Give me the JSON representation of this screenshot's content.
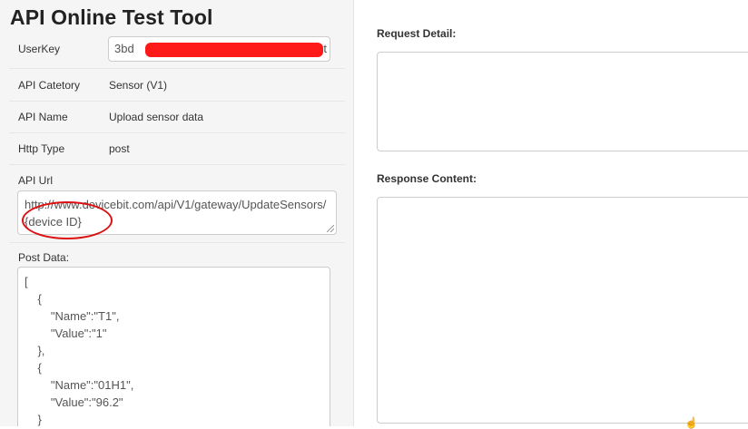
{
  "page": {
    "title": "API Online Test Tool"
  },
  "form": {
    "userkey": {
      "label": "UserKey",
      "value": "3bd",
      "suffix": "t"
    },
    "api_category": {
      "label": "API Catetory",
      "value": "Sensor (V1)"
    },
    "api_name": {
      "label": "API Name",
      "value": "Upload sensor data"
    },
    "http_type": {
      "label": "Http Type",
      "value": "post"
    },
    "api_url": {
      "label": "API Url",
      "value": "http://www.devicebit.com/api/V1/gateway/UpdateSensors/{device ID}"
    },
    "post_data": {
      "label": "Post Data:",
      "value": "[\n    {\n        \"Name\":\"T1\",\n        \"Value\":\"1\"\n    },\n    {\n        \"Name\":\"01H1\",\n        \"Value\":\"96.2\"\n    }"
    }
  },
  "right": {
    "request_label": "Request Detail:",
    "response_label": "Response Content:"
  },
  "annotation": {
    "color": "#dd1111",
    "redaction_color": "#ff1a1a"
  }
}
